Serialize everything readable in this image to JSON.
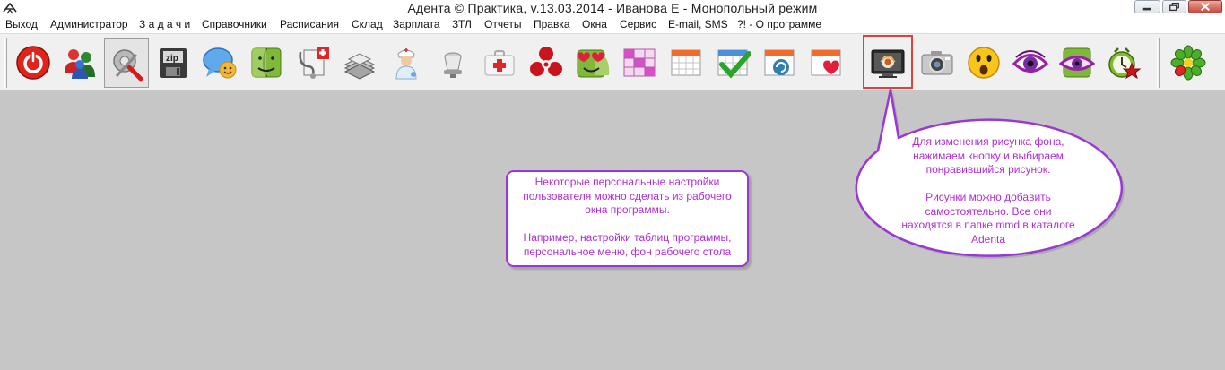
{
  "window": {
    "title": "Адента © Практика, v.13.03.2014 - Иванова Е - Монопольный режим"
  },
  "menu": {
    "items": [
      {
        "label": "Выход"
      },
      {
        "label": "Администратор"
      },
      {
        "label": "З а д а ч и"
      },
      {
        "label": "Справочники"
      },
      {
        "label": "Расписания"
      },
      {
        "label": "Склад"
      },
      {
        "label": "Зарплата"
      },
      {
        "label": "ЗТЛ"
      },
      {
        "label": "Отчеты"
      },
      {
        "label": "Правка"
      },
      {
        "label": "Окна"
      },
      {
        "label": "Сервис"
      },
      {
        "label": "E-mail, SMS"
      },
      {
        "label": "?! - О программе"
      }
    ]
  },
  "toolbar": {
    "buttons": [
      {
        "icon": "power-icon"
      },
      {
        "icon": "users-icon"
      },
      {
        "icon": "tools-icon",
        "pressed": true
      },
      {
        "icon": "zip-archive-icon"
      },
      {
        "icon": "chat-icon"
      },
      {
        "icon": "finder-face-icon"
      },
      {
        "icon": "stethoscope-icon"
      },
      {
        "icon": "documents-stack-icon"
      },
      {
        "icon": "nurse-icon"
      },
      {
        "icon": "dental-chair-icon"
      },
      {
        "icon": "first-aid-kit-icon"
      },
      {
        "icon": "biohazard-icon"
      },
      {
        "icon": "love-face-icon"
      },
      {
        "icon": "pink-grid-icon"
      },
      {
        "icon": "calendar-icon"
      },
      {
        "icon": "calendar-check-icon"
      },
      {
        "icon": "calendar-refresh-icon"
      },
      {
        "icon": "calendar-heart-icon"
      },
      {
        "icon": "monitor-background-icon",
        "highlighted": true
      },
      {
        "icon": "camera-icon"
      },
      {
        "icon": "surprised-face-icon"
      },
      {
        "icon": "eye-icon"
      },
      {
        "icon": "eye-finder-icon"
      },
      {
        "icon": "star-alarm-icon"
      },
      {
        "icon": "icq-flower-icon"
      }
    ]
  },
  "callouts": {
    "settings_note": {
      "lines": [
        "Некоторые персональные настройки",
        "пользователя можно сделать из рабочего",
        "окна программы.",
        "",
        "Например, настройки таблиц программы,",
        "персональное меню, фон рабочего стола"
      ]
    },
    "background_note": {
      "lines": [
        "Для изменения рисунка фона,",
        "нажимаем кнопку и выбираем",
        "понравившийся рисунок.",
        "",
        "Рисунки можно добавить",
        "самостоятельно. Все они",
        "находятся в папке mmd в каталоге",
        "Adenta"
      ]
    }
  },
  "colors": {
    "workspace": "#c6c6c6",
    "callout_border": "#9a37d6",
    "callout_text": "#b12cd6",
    "highlight": "#e0413a"
  }
}
